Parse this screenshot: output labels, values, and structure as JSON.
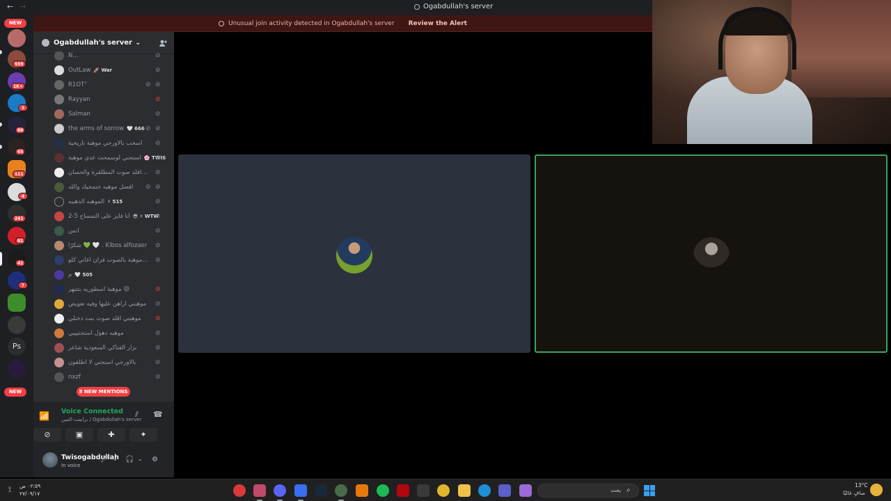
{
  "window": {
    "title": "Ogabdullah's server",
    "back": "←",
    "forward": "→"
  },
  "alert": {
    "text": "Unusual join activity detected in Ogabdullah's server",
    "action": "Review the Alert"
  },
  "server_rail": {
    "new_top": "NEW",
    "new_bottom": "NEW",
    "badges": [
      "559",
      "1K+",
      "3",
      "88",
      "65",
      "111",
      "4",
      "241",
      "81",
      "42",
      "7"
    ],
    "ps_label": "Ps"
  },
  "server": {
    "name": "Ogabdullah's server",
    "chevron": "⌄",
    "invite_icon": "person-add-icon"
  },
  "members": [
    {
      "name": "N...",
      "tag": ""
    },
    {
      "name": "OutLaw",
      "tag": "🚀 War"
    },
    {
      "name": "R1OT⁷",
      "tag": ""
    },
    {
      "name": "Rayyan",
      "tag": ""
    },
    {
      "name": "Salman",
      "tag": ""
    },
    {
      "name": "the arms of sorrow",
      "tag": "🤍 666"
    },
    {
      "name": "اسحب بالاورجي موهبة تاريخية",
      "tag": ""
    },
    {
      "name": "استجني لوسمحت عدي موهبة",
      "tag": "🌸 TWIS"
    },
    {
      "name": "اعرف افلد صوت المطلقرة والحصان",
      "tag": ""
    },
    {
      "name": "افضل موهبه ختمجيك والله",
      "tag": ""
    },
    {
      "name": "الموهبه الذهبيه",
      "tag": "⚡ 515"
    },
    {
      "name": "2-5 انا فايز على التمساح",
      "tag": "😎 ⚡ WTW"
    },
    {
      "name": "انس",
      "tag": ""
    },
    {
      "name": "شكرًا 💚 🤍 . Kibos alfozaer",
      "tag": ""
    },
    {
      "name": "عدي موهبة بالصوت فزان اغاني كلو",
      "tag": ""
    },
    {
      "name": "م",
      "tag": "🤍 505"
    },
    {
      "name": "موهبة اسطوريه بتتبهر 😝",
      "tag": ""
    },
    {
      "name": "موهبتي اراهن عليها وفيه تعويض",
      "tag": ""
    },
    {
      "name": "موهبتي اقلد صوت بنت دختلي",
      "tag": ""
    },
    {
      "name": "موهبه دهول استجتيييي",
      "tag": ""
    },
    {
      "name": "نزار القتاكي السعودية شاعر",
      "tag": ""
    },
    {
      "name": "بالاورجي استجني لا اطلقون",
      "tag": ""
    },
    {
      "name": "nxzf",
      "tag": ""
    }
  ],
  "mentions": "8 NEW MENTIONS",
  "voice": {
    "status": "Voice Connected",
    "channel": "برايفت-المين / Ogabdullah's server",
    "buttons": [
      "camera-off-icon",
      "screen-share-icon",
      "activities-icon",
      "soundboard-icon"
    ]
  },
  "user": {
    "name": "Twisogabdullah",
    "status": "In voice",
    "mic": "🎤",
    "headset": "🎧",
    "settings": "⚙"
  },
  "taskbar": {
    "time": "٠٢:٥٩ ص",
    "date": "٢٧/٠٩/١٧",
    "search_placeholder": "بحث",
    "weather_temp": "13°C",
    "weather_desc": "صافٍ غالبًا"
  }
}
